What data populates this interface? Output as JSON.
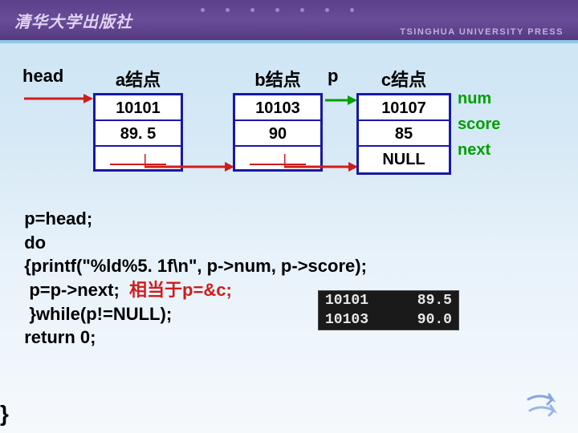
{
  "header": {
    "logo_zh": "清华大学出版社",
    "press_en": "TSINGHUA UNIVERSITY PRESS"
  },
  "diagram": {
    "head_label": "head",
    "p_label": "p",
    "fields": {
      "num": "num",
      "score": "score",
      "next": "next"
    },
    "nodes": {
      "a": {
        "title": "a结点",
        "num": "10101",
        "score": "89. 5"
      },
      "b": {
        "title": "b结点",
        "num": "10103",
        "score": "90"
      },
      "c": {
        "title": "c结点",
        "num": "10107",
        "score": "85",
        "next": "NULL"
      }
    }
  },
  "code": {
    "l1": "  p=head;",
    "l2": "  do",
    "l3": "  {printf(\"%ld%5. 1f\\n\", p->num, p->score);",
    "l4a": "   p=p->next;  ",
    "l4b": "相当于p=&c;",
    "l5": "   }while(p!=NULL);",
    "l6": "  return 0;",
    "l7": "}"
  },
  "console": {
    "rows": [
      {
        "num": "10101",
        "score": "89.5"
      },
      {
        "num": "10103",
        "score": "90.0"
      }
    ]
  }
}
